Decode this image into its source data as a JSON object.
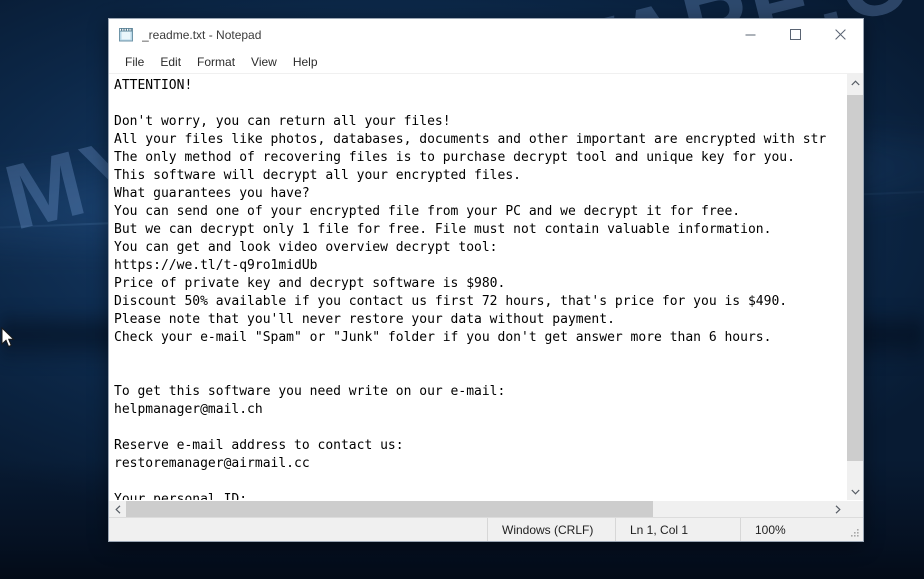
{
  "desktop": {
    "watermark": "MYANTISPYWARE.COM",
    "cursor_icon": "mouse-pointer-icon"
  },
  "window": {
    "title": "_readme.txt - Notepad",
    "icon": "notepad-icon",
    "controls": {
      "minimize": "minimize-icon",
      "maximize": "maximize-icon",
      "close": "close-icon"
    }
  },
  "menu": {
    "items": [
      {
        "label": "File"
      },
      {
        "label": "Edit"
      },
      {
        "label": "Format"
      },
      {
        "label": "View"
      },
      {
        "label": "Help"
      }
    ]
  },
  "document": {
    "filename": "_readme.txt",
    "content": "ATTENTION!\n\nDon't worry, you can return all your files!\nAll your files like photos, databases, documents and other important are encrypted with str\nThe only method of recovering files is to purchase decrypt tool and unique key for you.\nThis software will decrypt all your encrypted files.\nWhat guarantees you have?\nYou can send one of your encrypted file from your PC and we decrypt it for free.\nBut we can decrypt only 1 file for free. File must not contain valuable information.\nYou can get and look video overview decrypt tool:\nhttps://we.tl/t-q9ro1midUb\nPrice of private key and decrypt software is $980.\nDiscount 50% available if you contact us first 72 hours, that's price for you is $490.\nPlease note that you'll never restore your data without payment.\nCheck your e-mail \"Spam\" or \"Junk\" folder if you don't get answer more than 6 hours.\n\n\nTo get this software you need write on our e-mail:\nhelpmanager@mail.ch\n\nReserve e-mail address to contact us:\nrestoremanager@airmail.cc\n\nYour personal ID:",
    "ransom": {
      "price_full": "$980",
      "price_discount": "$490",
      "discount_percent": "50%",
      "discount_window_hours": "72",
      "response_time_hours": "6",
      "free_decrypt_files": "1",
      "video_url": "https://we.tl/t-q9ro1midUb",
      "primary_email": "helpmanager@mail.ch",
      "reserve_email": "restoremanager@airmail.cc"
    }
  },
  "scrollbars": {
    "vertical": {
      "up_icon": "chevron-up-icon",
      "down_icon": "chevron-down-icon"
    },
    "horizontal": {
      "left_icon": "chevron-left-icon",
      "right_icon": "chevron-right-icon"
    }
  },
  "statusbar": {
    "encoding": "Windows (CRLF)",
    "position": "Ln 1, Col 1",
    "zoom": "100%"
  }
}
